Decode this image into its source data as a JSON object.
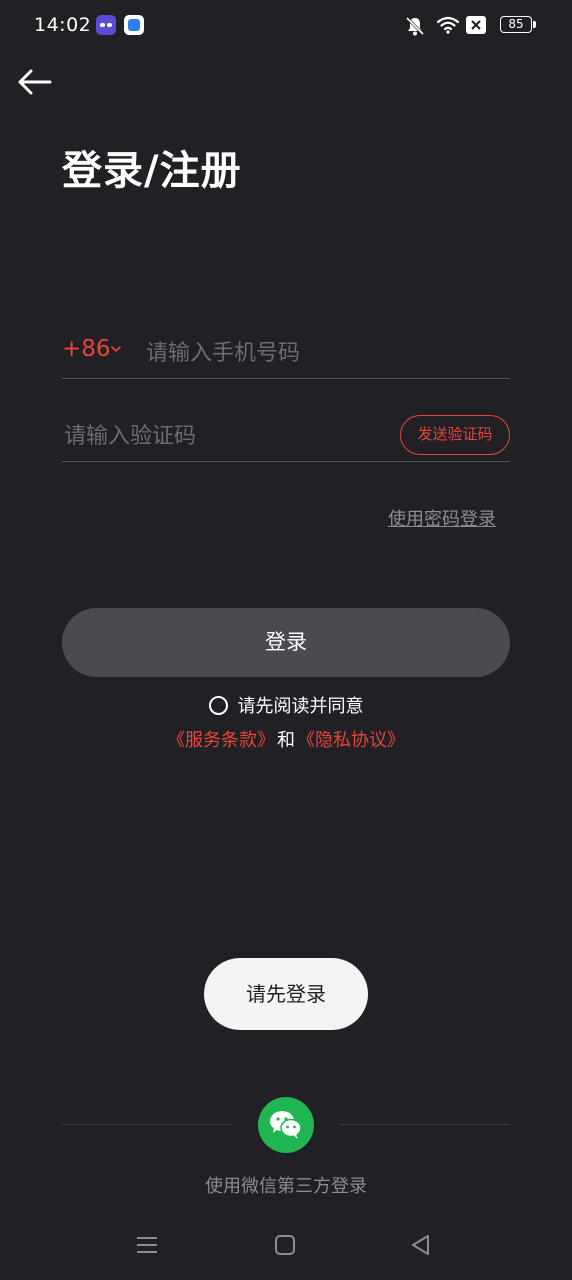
{
  "status_bar": {
    "time": "14:02",
    "battery": "85",
    "icons": [
      "app-icon-1",
      "app-icon-2",
      "mute-icon",
      "wifi-icon",
      "notification-icon",
      "battery-icon"
    ]
  },
  "header": {
    "back_icon": "back-arrow-icon",
    "title": "登录/注册"
  },
  "form": {
    "country_code": "+86",
    "phone_placeholder": "请输入手机号码",
    "code_placeholder": "请输入验证码",
    "send_code_label": "发送验证码",
    "password_login_label": "使用密码登录",
    "login_button_label": "登录"
  },
  "agreement": {
    "prompt": "请先阅读并同意",
    "terms_label": "《服务条款》",
    "and_label": "和",
    "privacy_label": "《隐私协议》"
  },
  "toast": {
    "message": "请先登录"
  },
  "third_party": {
    "wechat_icon": "wechat-icon",
    "label": "使用微信第三方登录"
  },
  "colors": {
    "background": "#212024",
    "accent": "#e8443a",
    "button_bg": "#4a4a51",
    "wechat_green": "#1fb552"
  },
  "nav_bar": {
    "icons": [
      "menu-icon",
      "home-icon",
      "back-triangle-icon"
    ]
  }
}
